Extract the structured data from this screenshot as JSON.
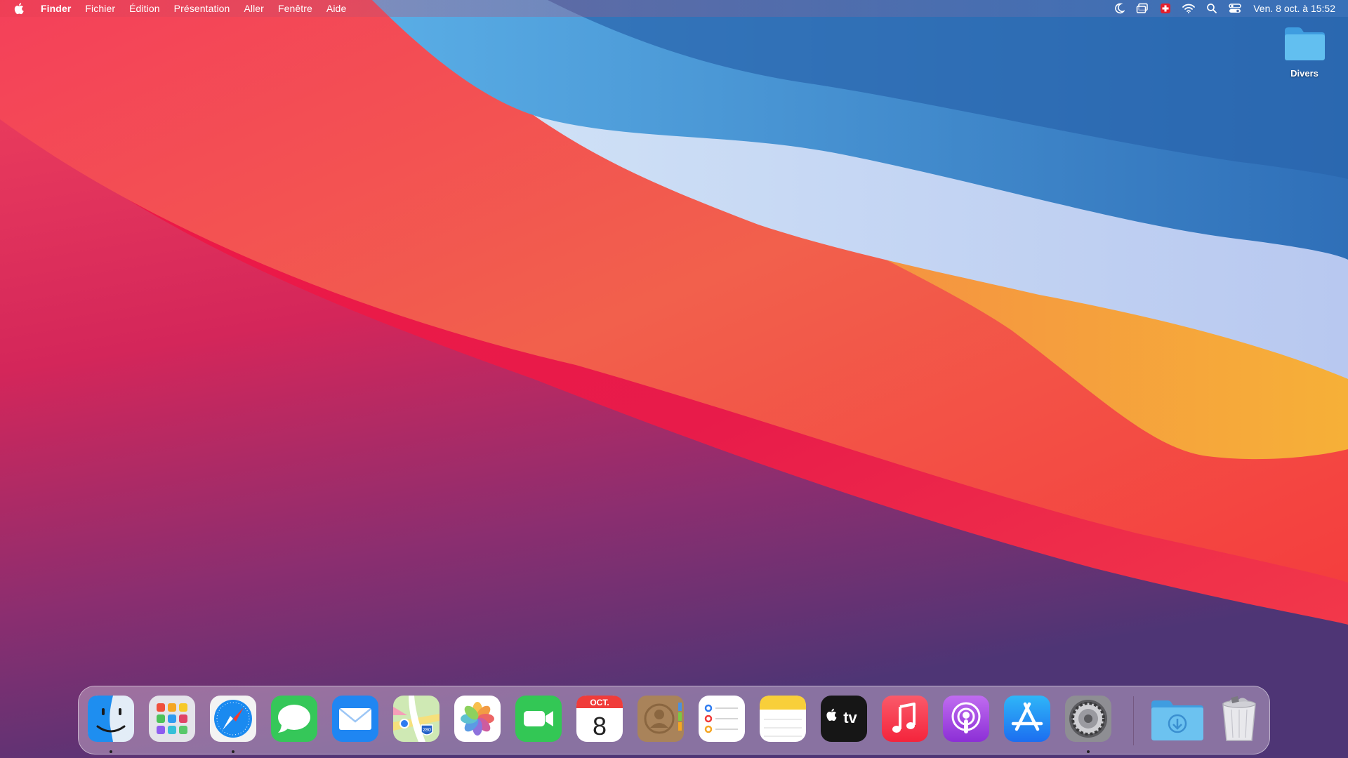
{
  "menubar": {
    "apple_icon": "apple-logo-icon",
    "app_name": "Finder",
    "menus": [
      "Fichier",
      "Édition",
      "Présentation",
      "Aller",
      "Fenêtre",
      "Aide"
    ],
    "status_icons": [
      "moon-icon",
      "screen-mirroring-icon",
      "swiss-flag-icon",
      "wifi-icon",
      "search-icon",
      "control-center-icon"
    ],
    "clock": "Ven. 8 oct. à  15:52"
  },
  "desktop": {
    "folder_label": "Divers"
  },
  "dock": {
    "apps": [
      {
        "name": "Finder",
        "icon": "finder-icon",
        "running": true
      },
      {
        "name": "Launchpad",
        "icon": "launchpad-icon",
        "running": false
      },
      {
        "name": "Safari",
        "icon": "safari-icon",
        "running": true
      },
      {
        "name": "Messages",
        "icon": "messages-icon",
        "running": false
      },
      {
        "name": "Mail",
        "icon": "mail-icon",
        "running": false
      },
      {
        "name": "Plans",
        "icon": "maps-icon",
        "running": false
      },
      {
        "name": "Photos",
        "icon": "photos-icon",
        "running": false
      },
      {
        "name": "FaceTime",
        "icon": "facetime-icon",
        "running": false
      },
      {
        "name": "Calendrier",
        "icon": "calendar-icon",
        "running": false
      },
      {
        "name": "Contacts",
        "icon": "contacts-icon",
        "running": false
      },
      {
        "name": "Rappels",
        "icon": "reminders-icon",
        "running": false
      },
      {
        "name": "Notes",
        "icon": "notes-icon",
        "running": false
      },
      {
        "name": "TV",
        "icon": "apple-tv-icon",
        "running": false
      },
      {
        "name": "Musique",
        "icon": "music-icon",
        "running": false
      },
      {
        "name": "Podcasts",
        "icon": "podcasts-icon",
        "running": false
      },
      {
        "name": "App Store",
        "icon": "app-store-icon",
        "running": false
      },
      {
        "name": "Préférences Système",
        "icon": "system-preferences-icon",
        "running": true
      }
    ],
    "calendar_month": "OCT.",
    "calendar_day": "8",
    "maps_shield": "280",
    "tv_label": "tv",
    "downloads_icon": "downloads-folder-icon",
    "trash_icon": "trash-full-icon"
  },
  "colors": {
    "dock_bg": "#ebd7eb",
    "folder_blue": "#5fb8ec"
  }
}
